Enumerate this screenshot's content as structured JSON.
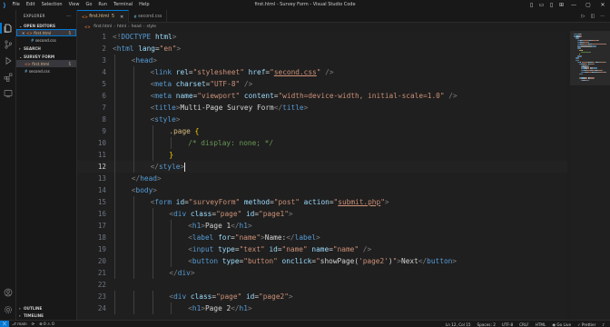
{
  "window": {
    "title": "first.html - Survey Form - Visual Studio Code",
    "menu": [
      "File",
      "Edit",
      "Selection",
      "View",
      "Go",
      "Run",
      "Terminal",
      "Help"
    ]
  },
  "sidebar": {
    "header": "EXPLORER",
    "more": "···",
    "open_editors": {
      "label": "OPEN EDITORS",
      "files": [
        {
          "name": "first.html",
          "badge": "5",
          "type": "html"
        },
        {
          "name": "second.css",
          "type": "css"
        }
      ]
    },
    "search_label": "SEARCH",
    "workspace": {
      "label": "SURVEY FORM",
      "files": [
        {
          "name": "first.html",
          "badge": "5",
          "type": "html"
        },
        {
          "name": "second.css",
          "type": "css"
        }
      ]
    },
    "outline_label": "OUTLINE",
    "timeline_label": "TIMELINE"
  },
  "tabs": [
    {
      "name": "first.html",
      "badge": "5",
      "type": "html",
      "active": true
    },
    {
      "name": "second.css",
      "type": "css",
      "active": false
    }
  ],
  "breadcrumb": [
    "first.html",
    "html",
    "head",
    "style"
  ],
  "editor": {
    "current_line": 12,
    "lines": [
      {
        "n": 1,
        "indent": 0,
        "tokens": [
          [
            "br",
            "<!"
          ],
          [
            "tag",
            "DOCTYPE"
          ],
          [
            "txt",
            " "
          ],
          [
            "attr",
            "html"
          ],
          [
            "br",
            ">"
          ]
        ]
      },
      {
        "n": 2,
        "indent": 0,
        "tokens": [
          [
            "br",
            "<"
          ],
          [
            "tag",
            "html"
          ],
          [
            "txt",
            " "
          ],
          [
            "attr",
            "lang"
          ],
          [
            "txt",
            "="
          ],
          [
            "str",
            "\"en\""
          ],
          [
            "br",
            ">"
          ]
        ]
      },
      {
        "n": 3,
        "indent": 1,
        "tokens": [
          [
            "br",
            "<"
          ],
          [
            "tag",
            "head"
          ],
          [
            "br",
            ">"
          ]
        ]
      },
      {
        "n": 4,
        "indent": 2,
        "tokens": [
          [
            "br",
            "<"
          ],
          [
            "tag",
            "link"
          ],
          [
            "txt",
            " "
          ],
          [
            "attr",
            "rel"
          ],
          [
            "txt",
            "="
          ],
          [
            "str",
            "\"stylesheet\""
          ],
          [
            "txt",
            " "
          ],
          [
            "attr",
            "href"
          ],
          [
            "txt",
            "="
          ],
          [
            "str",
            "\""
          ],
          [
            "strlink",
            "second.css"
          ],
          [
            "str",
            "\""
          ],
          [
            "txt",
            " "
          ],
          [
            "br",
            "/>"
          ]
        ]
      },
      {
        "n": 5,
        "indent": 2,
        "tokens": [
          [
            "br",
            "<"
          ],
          [
            "tag",
            "meta"
          ],
          [
            "txt",
            " "
          ],
          [
            "attr",
            "charset"
          ],
          [
            "txt",
            "="
          ],
          [
            "str",
            "\"UTF-8\""
          ],
          [
            "txt",
            " "
          ],
          [
            "br",
            "/>"
          ]
        ]
      },
      {
        "n": 6,
        "indent": 2,
        "tokens": [
          [
            "br",
            "<"
          ],
          [
            "tag",
            "meta"
          ],
          [
            "txt",
            " "
          ],
          [
            "attr",
            "name"
          ],
          [
            "txt",
            "="
          ],
          [
            "str",
            "\"viewport\""
          ],
          [
            "txt",
            " "
          ],
          [
            "attr",
            "content"
          ],
          [
            "txt",
            "="
          ],
          [
            "str",
            "\"width=device-width, initial-scale=1.0\""
          ],
          [
            "txt",
            " "
          ],
          [
            "br",
            "/>"
          ]
        ]
      },
      {
        "n": 7,
        "indent": 2,
        "tokens": [
          [
            "br",
            "<"
          ],
          [
            "tag",
            "title"
          ],
          [
            "br",
            ">"
          ],
          [
            "txt",
            "Multi-Page Survey Form"
          ],
          [
            "br",
            "</"
          ],
          [
            "tag",
            "title"
          ],
          [
            "br",
            ">"
          ]
        ]
      },
      {
        "n": 8,
        "indent": 2,
        "tokens": [
          [
            "br",
            "<"
          ],
          [
            "tag",
            "style"
          ],
          [
            "br",
            ">"
          ]
        ]
      },
      {
        "n": 9,
        "indent": 3,
        "tokens": [
          [
            "sel",
            ".page"
          ],
          [
            "txt",
            " "
          ],
          [
            "bk1",
            "{"
          ]
        ]
      },
      {
        "n": 10,
        "indent": 4,
        "tokens": [
          [
            "com",
            "/* display: none; */"
          ]
        ]
      },
      {
        "n": 11,
        "indent": 3,
        "tokens": [
          [
            "bk1",
            "}"
          ]
        ]
      },
      {
        "n": 12,
        "indent": 2,
        "tokens": [
          [
            "br",
            "</"
          ],
          [
            "tag",
            "style"
          ],
          [
            "br",
            ">"
          ],
          [
            "cursor",
            ""
          ]
        ]
      },
      {
        "n": 13,
        "indent": 1,
        "tokens": [
          [
            "br",
            "</"
          ],
          [
            "tag",
            "head"
          ],
          [
            "br",
            ">"
          ]
        ]
      },
      {
        "n": 14,
        "indent": 1,
        "tokens": [
          [
            "br",
            "<"
          ],
          [
            "tag",
            "body"
          ],
          [
            "br",
            ">"
          ]
        ]
      },
      {
        "n": 15,
        "indent": 2,
        "tokens": [
          [
            "br",
            "<"
          ],
          [
            "tag",
            "form"
          ],
          [
            "txt",
            " "
          ],
          [
            "attr",
            "id"
          ],
          [
            "txt",
            "="
          ],
          [
            "str",
            "\"surveyForm\""
          ],
          [
            "txt",
            " "
          ],
          [
            "attr",
            "method"
          ],
          [
            "txt",
            "="
          ],
          [
            "str",
            "\"post\""
          ],
          [
            "txt",
            " "
          ],
          [
            "attr",
            "action"
          ],
          [
            "txt",
            "="
          ],
          [
            "str",
            "\""
          ],
          [
            "strlink",
            "submit.php"
          ],
          [
            "str",
            "\""
          ],
          [
            "br",
            ">"
          ]
        ]
      },
      {
        "n": 16,
        "indent": 3,
        "tokens": [
          [
            "br",
            "<"
          ],
          [
            "tag",
            "div"
          ],
          [
            "txt",
            " "
          ],
          [
            "attr",
            "class"
          ],
          [
            "txt",
            "="
          ],
          [
            "str",
            "\"page\""
          ],
          [
            "txt",
            " "
          ],
          [
            "attr",
            "id"
          ],
          [
            "txt",
            "="
          ],
          [
            "str",
            "\"page1\""
          ],
          [
            "br",
            ">"
          ]
        ]
      },
      {
        "n": 17,
        "indent": 4,
        "tokens": [
          [
            "br",
            "<"
          ],
          [
            "tag",
            "h1"
          ],
          [
            "br",
            ">"
          ],
          [
            "txt",
            "Page 1"
          ],
          [
            "br",
            "</"
          ],
          [
            "tag",
            "h1"
          ],
          [
            "br",
            ">"
          ]
        ]
      },
      {
        "n": 18,
        "indent": 4,
        "tokens": [
          [
            "br",
            "<"
          ],
          [
            "tag",
            "label"
          ],
          [
            "txt",
            " "
          ],
          [
            "attr",
            "for"
          ],
          [
            "txt",
            "="
          ],
          [
            "str",
            "\"name\""
          ],
          [
            "br",
            ">"
          ],
          [
            "txt",
            "Name:"
          ],
          [
            "br",
            "</"
          ],
          [
            "tag",
            "label"
          ],
          [
            "br",
            ">"
          ]
        ]
      },
      {
        "n": 19,
        "indent": 4,
        "tokens": [
          [
            "br",
            "<"
          ],
          [
            "tag",
            "input"
          ],
          [
            "txt",
            " "
          ],
          [
            "attr",
            "type"
          ],
          [
            "txt",
            "="
          ],
          [
            "str",
            "\"text\""
          ],
          [
            "txt",
            " "
          ],
          [
            "attr",
            "id"
          ],
          [
            "txt",
            "="
          ],
          [
            "str",
            "\"name\""
          ],
          [
            "txt",
            " "
          ],
          [
            "attr",
            "name"
          ],
          [
            "txt",
            "="
          ],
          [
            "str",
            "\"name\""
          ],
          [
            "txt",
            " "
          ],
          [
            "br",
            "/>"
          ]
        ]
      },
      {
        "n": 20,
        "indent": 4,
        "tokens": [
          [
            "br",
            "<"
          ],
          [
            "tag",
            "button"
          ],
          [
            "txt",
            " "
          ],
          [
            "attr",
            "type"
          ],
          [
            "txt",
            "="
          ],
          [
            "str",
            "\"button\""
          ],
          [
            "txt",
            " "
          ],
          [
            "attr",
            "onclick"
          ],
          [
            "txt",
            "="
          ],
          [
            "str",
            "\""
          ],
          [
            "txt",
            "showPage("
          ],
          [
            "str",
            "'page2'"
          ],
          [
            "txt",
            ")"
          ],
          [
            "str",
            "\""
          ],
          [
            "br",
            ">"
          ],
          [
            "txt",
            "Next"
          ],
          [
            "br",
            "</"
          ],
          [
            "tag",
            "button"
          ],
          [
            "br",
            ">"
          ]
        ]
      },
      {
        "n": 21,
        "indent": 3,
        "tokens": [
          [
            "br",
            "</"
          ],
          [
            "tag",
            "div"
          ],
          [
            "br",
            ">"
          ]
        ]
      },
      {
        "n": 22,
        "indent": 0,
        "tokens": []
      },
      {
        "n": 23,
        "indent": 3,
        "tokens": [
          [
            "br",
            "<"
          ],
          [
            "tag",
            "div"
          ],
          [
            "txt",
            " "
          ],
          [
            "attr",
            "class"
          ],
          [
            "txt",
            "="
          ],
          [
            "str",
            "\"page\""
          ],
          [
            "txt",
            " "
          ],
          [
            "attr",
            "id"
          ],
          [
            "txt",
            "="
          ],
          [
            "str",
            "\"page2\""
          ],
          [
            "br",
            ">"
          ]
        ]
      },
      {
        "n": 24,
        "indent": 4,
        "tokens": [
          [
            "br",
            "<"
          ],
          [
            "tag",
            "h1"
          ],
          [
            "br",
            ">"
          ],
          [
            "txt",
            "Page 2"
          ],
          [
            "br",
            "</"
          ],
          [
            "tag",
            "h1"
          ],
          [
            "br",
            ">"
          ]
        ]
      }
    ]
  },
  "statusbar": {
    "branch": "main",
    "sync": "⟳",
    "errors": "0",
    "warnings": "0",
    "position": "Ln 12, Col 15",
    "spaces": "Spaces: 2",
    "encoding": "UTF-8",
    "eol": "CRLF",
    "language": "HTML",
    "golive": "Go Live",
    "prettier": "Prettier"
  },
  "colors": {
    "accent": "#0078d4",
    "tag": "#569cd6",
    "attribute": "#9cdcfe",
    "string": "#ce9178",
    "comment": "#6a9955",
    "modified": "#e2c08d"
  }
}
